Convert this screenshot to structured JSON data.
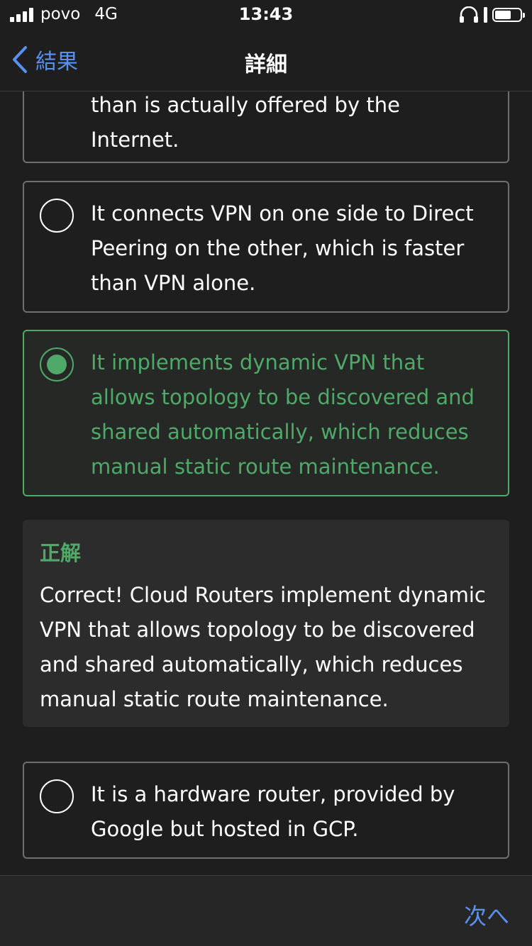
{
  "status_bar": {
    "carrier": "povo",
    "network": "4G",
    "time": "13:43"
  },
  "nav": {
    "back_label": "結果",
    "title": "詳細"
  },
  "options": [
    {
      "text": "bandwidth and get better throughput than is actually offered by the Internet.",
      "selected": false
    },
    {
      "text": "It connects VPN on one side to Direct Peering on the other, which is faster than VPN alone.",
      "selected": false
    },
    {
      "text": "It implements dynamic VPN that allows topology to be discovered and shared automatically, which reduces manual static route maintenance.",
      "selected": true
    },
    {
      "text": "It is a hardware router, provided by Google but hosted in GCP.",
      "selected": false
    }
  ],
  "explanation": {
    "heading": "正解",
    "body": "Correct! Cloud Routers implement dynamic VPN that allows topology to be discovered and shared automatically, which reduces manual static route maintenance."
  },
  "footer": {
    "next_label": "次へ"
  },
  "colors": {
    "accent_green": "#4fa968",
    "link_blue": "#5b8ff0",
    "background": "#1e1e1e"
  }
}
